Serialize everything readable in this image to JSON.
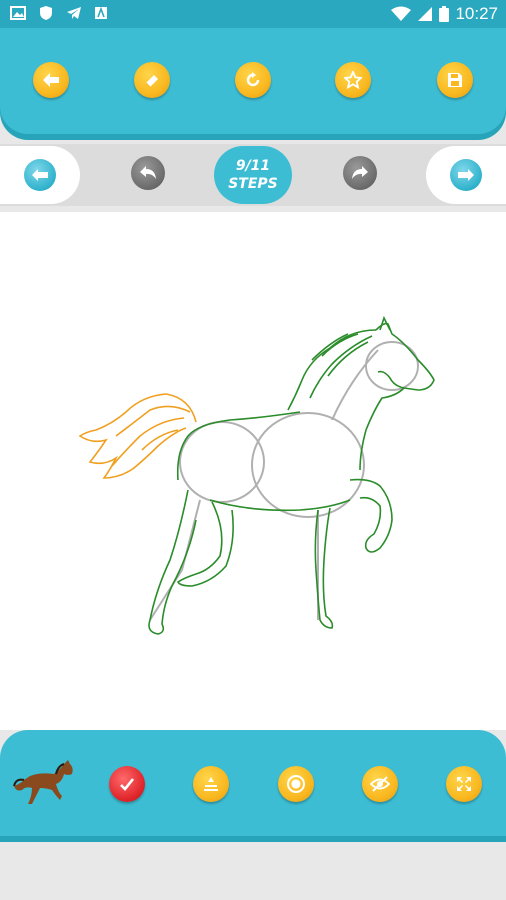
{
  "status_bar": {
    "time": "10:27",
    "left_icons": [
      "image-icon",
      "shield-icon",
      "telegram-icon",
      "app-icon"
    ],
    "right_icons": [
      "wifi-icon",
      "signal-icon",
      "battery-icon"
    ]
  },
  "top_toolbar": {
    "buttons": [
      {
        "name": "back-button",
        "icon": "arrow-left-icon"
      },
      {
        "name": "eraser-button",
        "icon": "eraser-icon"
      },
      {
        "name": "reset-button",
        "icon": "refresh-icon"
      },
      {
        "name": "rate-button",
        "icon": "star-icon"
      },
      {
        "name": "save-button",
        "icon": "floppy-disk-icon"
      }
    ]
  },
  "step_nav": {
    "steps_count": "9/11",
    "steps_label": "STEPS",
    "current_step": 9,
    "total_steps": 11
  },
  "drawing": {
    "subject": "horse",
    "colors": {
      "completed_lines": "#2a8c2a",
      "guide_lines": "#b0b0b0",
      "current_step_lines": "#f0a020"
    }
  },
  "bottom_toolbar": {
    "buttons": [
      {
        "name": "thumbnail-horse",
        "icon": "horse-thumbnail"
      },
      {
        "name": "done-button",
        "icon": "check-icon"
      },
      {
        "name": "stroke-width-button",
        "icon": "brush-size-icon"
      },
      {
        "name": "record-button",
        "icon": "record-icon"
      },
      {
        "name": "hide-guides-button",
        "icon": "eye-off-icon"
      },
      {
        "name": "fullscreen-button",
        "icon": "expand-icon"
      }
    ]
  },
  "colors": {
    "accent": "#3dbdd3",
    "accent_dark": "#27a4ba",
    "yellow": "#f9b820",
    "red": "#e0262c"
  }
}
